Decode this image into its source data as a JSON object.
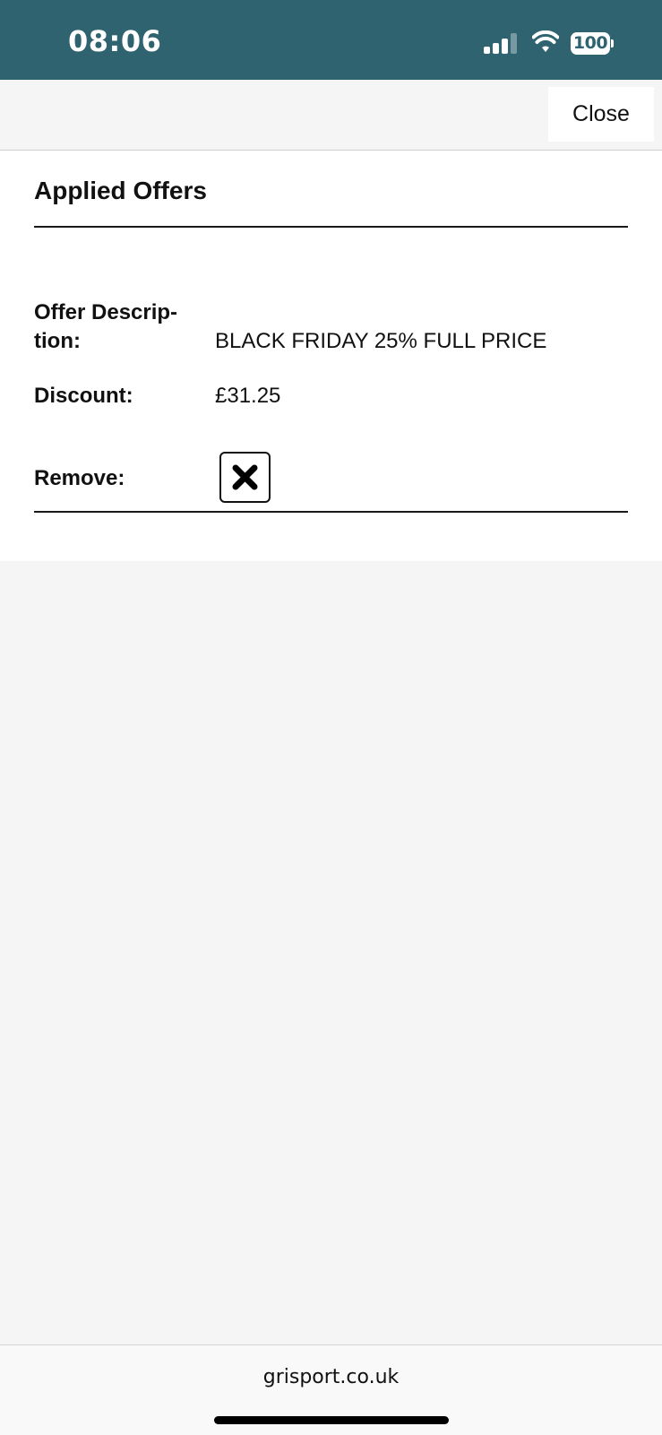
{
  "status_bar": {
    "time": "08:06",
    "battery": "100",
    "signal_icon": "cellular-signal-icon",
    "wifi_icon": "wifi-icon",
    "background_color": "#2f6370"
  },
  "top_bar": {
    "close_label": "Close"
  },
  "panel": {
    "title": "Applied Offers",
    "offer": {
      "description_label_line1": "Offer Descrip-",
      "description_label_line2": "tion:",
      "description_value": "BLACK FRIDAY 25% FULL PRICE",
      "discount_label": "Discount:",
      "discount_value": "£31.25",
      "remove_label": "Remove:",
      "remove_icon": "close-x-icon"
    }
  },
  "browser": {
    "url": "grisport.co.uk"
  }
}
